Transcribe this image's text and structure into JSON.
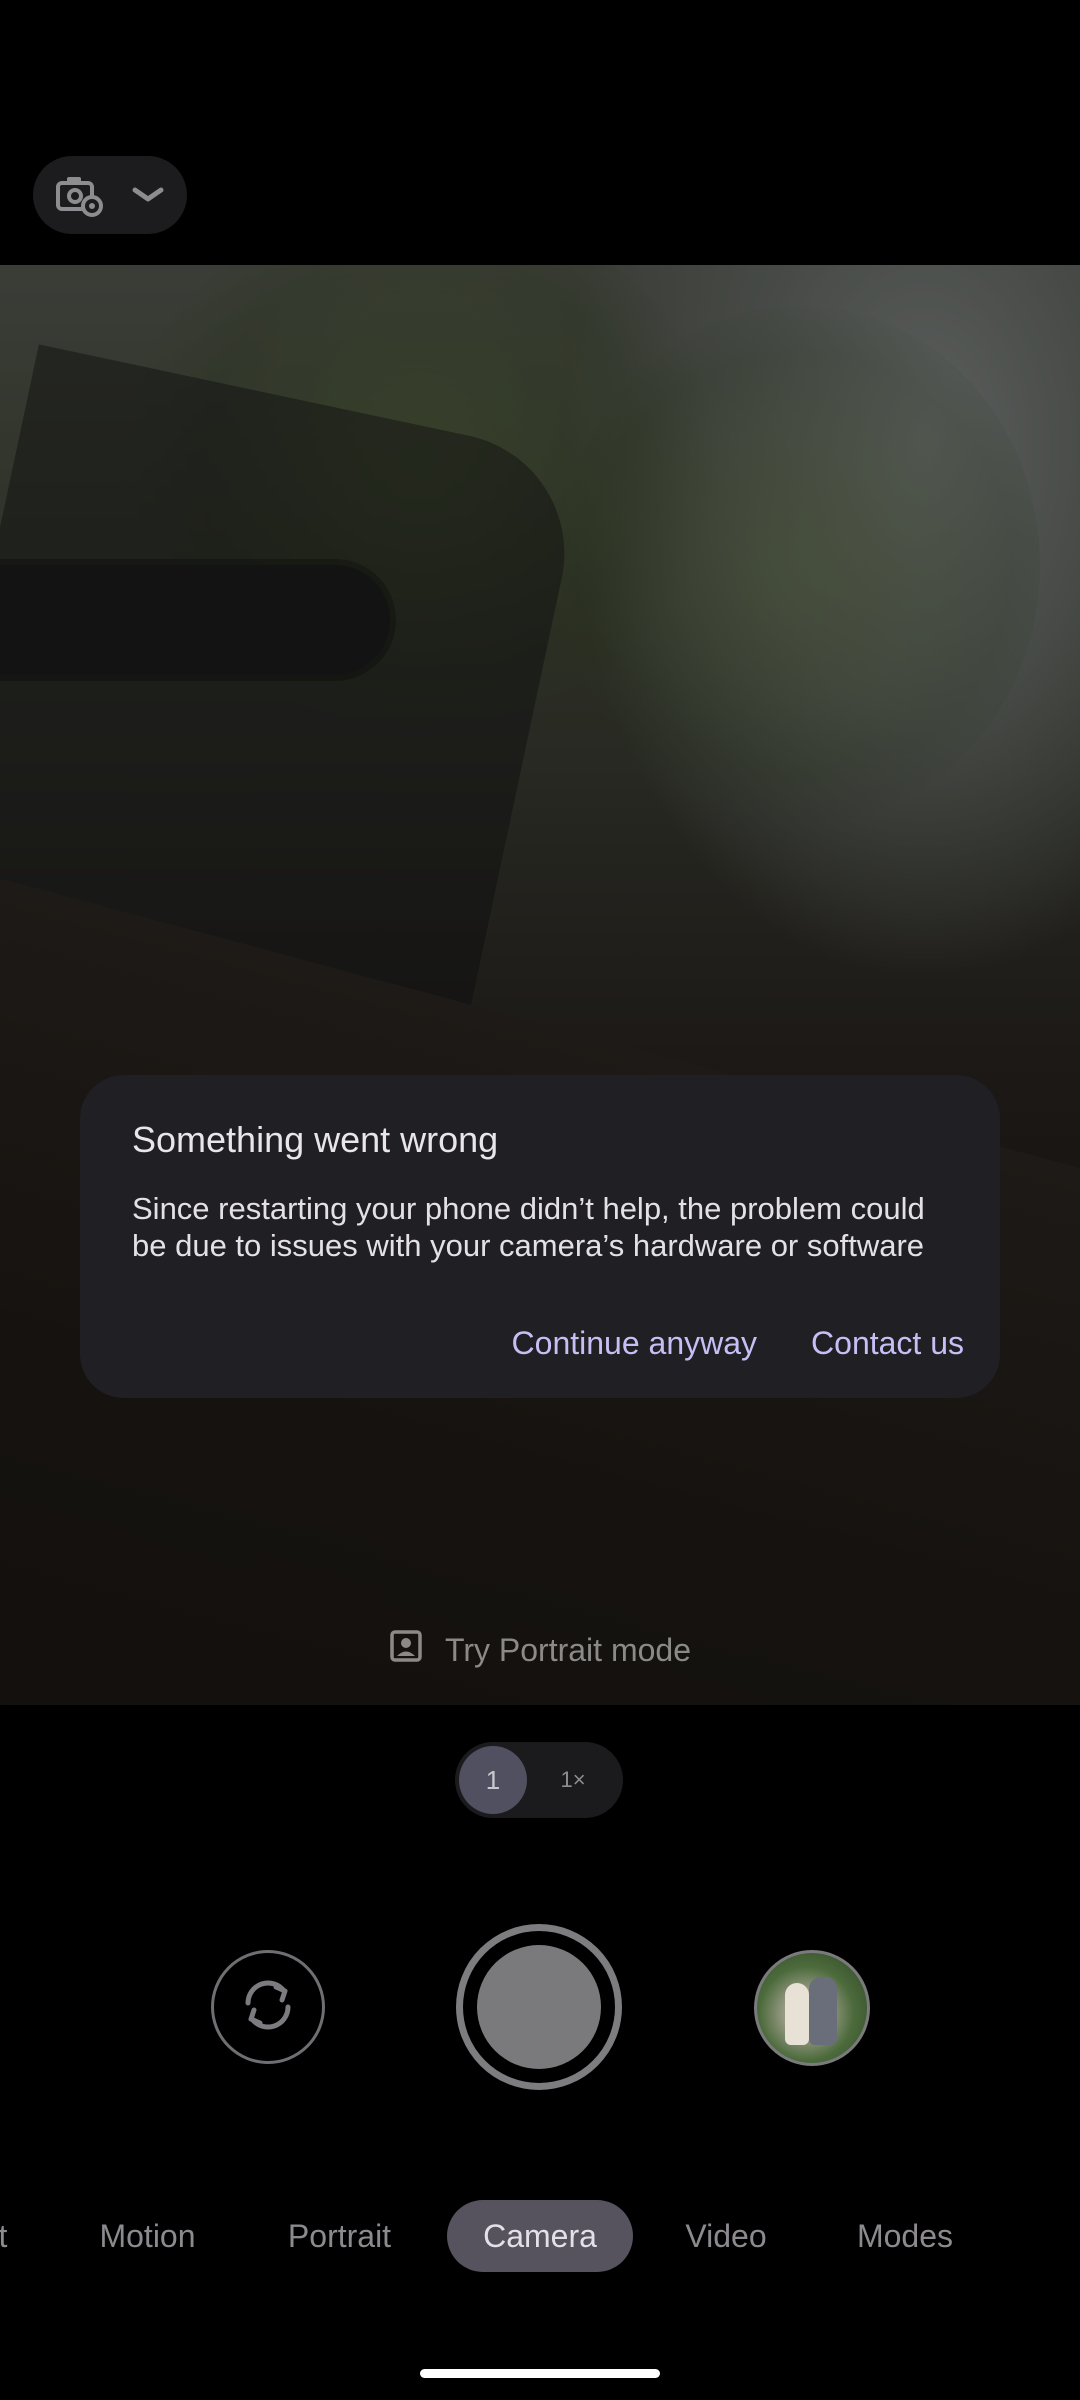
{
  "top_bar": {
    "settings_icon": "camera-settings-icon",
    "expand_icon": "chevron-down-icon"
  },
  "viewfinder": {
    "hint_icon": "portrait-icon",
    "hint_text": "Try Portrait mode"
  },
  "dialog": {
    "title": "Something went wrong",
    "body": "Since restarting your phone didn’t help, the problem could be due to issues with your camera’s hardware or software",
    "continue_label": "Continue anyway",
    "contact_label": "Contact us"
  },
  "zoom": {
    "active": "1",
    "other": "1×"
  },
  "controls": {
    "switch_icon": "switch-camera-icon",
    "gallery_icon": "gallery-thumbnail"
  },
  "modes": {
    "partial": "t",
    "motion": "Motion",
    "portrait": "Portrait",
    "camera": "Camera",
    "video": "Video",
    "more": "Modes"
  },
  "colors": {
    "accent": "#c6bff5",
    "dialog_bg": "#201f23",
    "mode_selected_bg": "#56535e"
  }
}
